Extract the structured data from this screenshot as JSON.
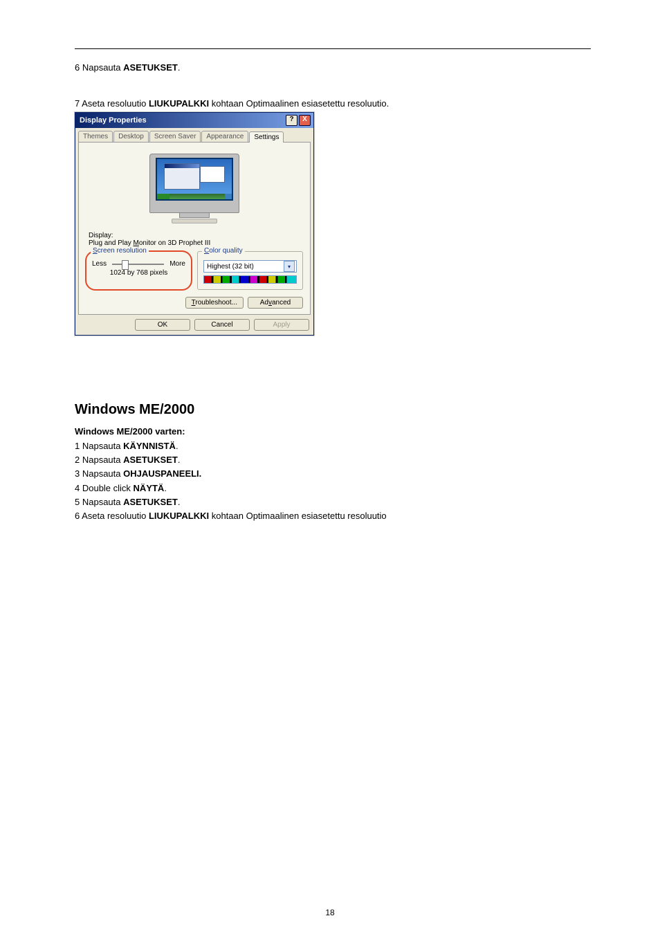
{
  "top": {
    "line1_prefix": "6 Napsauta ",
    "line1_bold": "ASETUKSET",
    "line1_suffix": ".",
    "line2_prefix": "7 Aseta resoluutio ",
    "line2_bold": "LIUKUPALKKI",
    "line2_suffix": " kohtaan Optimaalinen esiasetettu resoluutio."
  },
  "dialog": {
    "title": "Display Properties",
    "help": "?",
    "close": "X",
    "tabs": [
      "Themes",
      "Desktop",
      "Screen Saver",
      "Appearance",
      "Settings"
    ],
    "activeTabIndex": 4,
    "displayLabel": "Display:",
    "displayValue": "Plug and Play Monitor on 3D Prophet III",
    "groupRes": {
      "title_u": "S",
      "title_rest": "creen resolution",
      "less": "Less",
      "more": "More",
      "value": "1024 by 768 pixels"
    },
    "groupColor": {
      "title_u": "C",
      "title_rest": "olor quality",
      "selected": "Highest (32 bit)"
    },
    "btnTroubleshoot_u": "T",
    "btnTroubleshoot_rest": "roubleshoot...",
    "btnAdvanced_pre": "Ad",
    "btnAdvanced_u": "v",
    "btnAdvanced_post": "anced",
    "ok": "OK",
    "cancel": "Cancel",
    "apply": "Apply"
  },
  "section2": {
    "heading": "Windows ME/2000",
    "subheading": "Windows ME/2000 varten:",
    "items": [
      {
        "pre": "1 Napsauta ",
        "bold": "KÄYNNISTÄ",
        "post": "."
      },
      {
        "pre": "2 Napsauta ",
        "bold": "ASETUKSET",
        "post": "."
      },
      {
        "pre": "3 Napsauta ",
        "bold": "OHJAUSPANEELI.",
        "post": ""
      },
      {
        "pre": "4 Double click ",
        "bold": "NÄYTÄ",
        "post": "."
      },
      {
        "pre": "5 Napsauta ",
        "bold": "ASETUKSET",
        "post": "."
      },
      {
        "pre": "6 Aseta resoluutio ",
        "bold": "LIUKUPALKKI",
        "post": " kohtaan Optimaalinen esiasetettu resoluutio"
      }
    ]
  },
  "pageNumber": "18"
}
